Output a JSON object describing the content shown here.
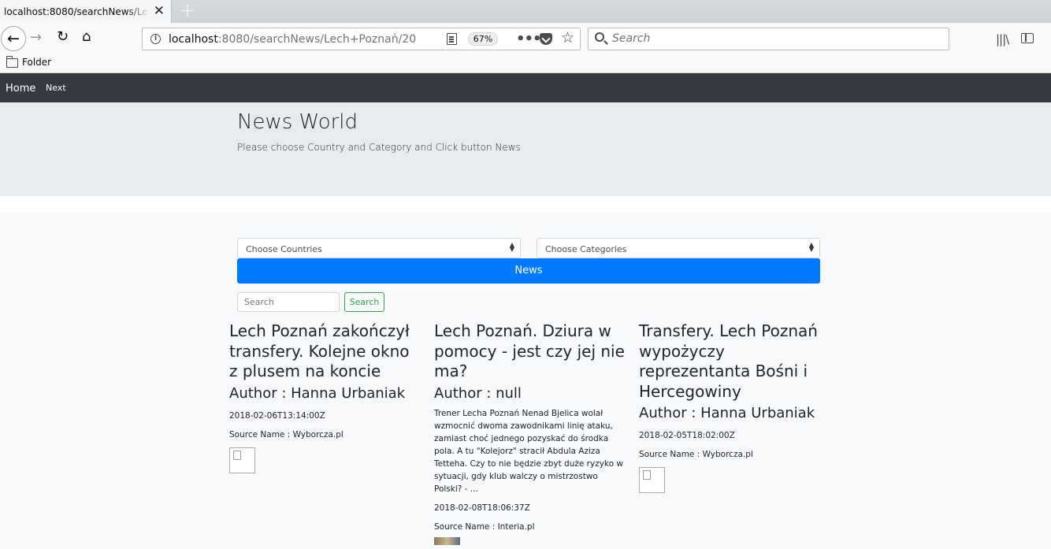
{
  "browser": {
    "tab_title": "localhost:8080/searchNews/Lech+Poznań/20",
    "url_host": "localhost",
    "url_path": ":8080/searchNews/Lech+Poznań/20",
    "zoom": "67%",
    "search_placeholder": "Search",
    "bookmark_folder": "Folder"
  },
  "site_nav": {
    "home": "Home",
    "next": "Next"
  },
  "jumbotron": {
    "title": "News World",
    "subtitle": "Please choose Country and Category and Click button News"
  },
  "filters": {
    "countries_placeholder": "Choose Countries",
    "categories_placeholder": "Choose Categories",
    "news_button": "News",
    "search_placeholder": "Search",
    "search_button": "Search"
  },
  "articles": [
    {
      "title": "Lech Poznań zakończył transfery. Kolejne okno z plusem na koncie",
      "author": "Author : Hanna Urbaniak",
      "description": "",
      "date": "2018-02-06T13:14:00Z",
      "source": "Source Name : Wyborcza.pl"
    },
    {
      "title": "Lech Poznań. Dziura w pomocy - jest czy jej nie ma?",
      "author": "Author : null",
      "description": "Trener Lecha Poznań Nenad Bjelica wolał wzmocnić dwoma zawodnikami linię ataku, zamiast choć jednego pozyskać do środka pola. A tu \"Kolejorz\" stracił Abdula Aziza Tetteha. Czy to nie będzie zbyt duże ryzyko w sytuacji, gdy klub walczy o mistrzostwo Polski? - ...",
      "date": "2018-02-08T18:06:37Z",
      "source": "Source Name : Interia.pl"
    },
    {
      "title": "Transfery. Lech Poznań wypożyczy reprezentanta Bośni i Hercegowiny",
      "author": "Author : Hanna Urbaniak",
      "description": "",
      "date": "2018-02-05T18:02:00Z",
      "source": "Source Name : Wyborcza.pl"
    }
  ]
}
